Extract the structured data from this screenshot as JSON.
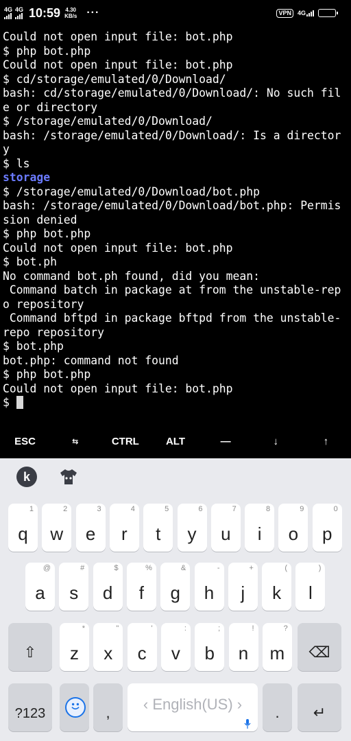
{
  "status_bar": {
    "sim1": "4G",
    "sim2": "4G",
    "time": "10:59",
    "speed_value": "4.30",
    "speed_unit": "KB/s",
    "more": "···",
    "vpn": "VPN",
    "network": "4G",
    "battery": "39"
  },
  "terminal": {
    "lines": [
      "Could not open input file: bot.php",
      "$ php bot.php",
      "Could not open input file: bot.php",
      "$ cd/storage/emulated/0/Download/",
      "bash: cd/storage/emulated/0/Download/: No such fil",
      "e or directory",
      "$ /storage/emulated/0/Download/",
      "bash: /storage/emulated/0/Download/: Is a director",
      "y",
      "$ ls",
      "storage",
      "$ /storage/emulated/0/Download/bot.php",
      "bash: /storage/emulated/0/Download/bot.php: Permis",
      "sion denied",
      "$ php bot.php",
      "Could not open input file: bot.php",
      "$ bot.ph",
      "No command bot.ph found, did you mean:",
      " Command batch in package at from the unstable-rep",
      "o repository",
      " Command bftpd in package bftpd from the unstable-",
      "repo repository",
      "$ bot.php",
      "bot.php: command not found",
      "$ php bot.php",
      "Could not open input file: bot.php"
    ],
    "prompt": "$ ",
    "dir_color": "#6b7bff"
  },
  "extra_keys": [
    "ESC",
    "⇆",
    "CTRL",
    "ALT",
    "—",
    "↓",
    "↑"
  ],
  "keyboard": {
    "logo": "k",
    "row1": [
      {
        "main": "q",
        "hint": "1"
      },
      {
        "main": "w",
        "hint": "2"
      },
      {
        "main": "e",
        "hint": "3"
      },
      {
        "main": "r",
        "hint": "4"
      },
      {
        "main": "t",
        "hint": "5"
      },
      {
        "main": "y",
        "hint": "6"
      },
      {
        "main": "u",
        "hint": "7"
      },
      {
        "main": "i",
        "hint": "8"
      },
      {
        "main": "o",
        "hint": "9"
      },
      {
        "main": "p",
        "hint": "0"
      }
    ],
    "row2": [
      {
        "main": "a",
        "hint": "@"
      },
      {
        "main": "s",
        "hint": "#"
      },
      {
        "main": "d",
        "hint": "$"
      },
      {
        "main": "f",
        "hint": "%"
      },
      {
        "main": "g",
        "hint": "&"
      },
      {
        "main": "h",
        "hint": "-"
      },
      {
        "main": "j",
        "hint": "+"
      },
      {
        "main": "k",
        "hint": "("
      },
      {
        "main": "l",
        "hint": ")"
      }
    ],
    "row3": [
      {
        "main": "z",
        "hint": "*"
      },
      {
        "main": "x",
        "hint": "\""
      },
      {
        "main": "c",
        "hint": "'"
      },
      {
        "main": "v",
        "hint": ":"
      },
      {
        "main": "b",
        "hint": ";"
      },
      {
        "main": "n",
        "hint": "!"
      },
      {
        "main": "m",
        "hint": "?"
      }
    ],
    "shift": "⇧",
    "backspace": "⌫",
    "symbols": "?123",
    "comma": ",",
    "space_label": "‹ English(US) ›",
    "period": ".",
    "enter": "↵"
  }
}
